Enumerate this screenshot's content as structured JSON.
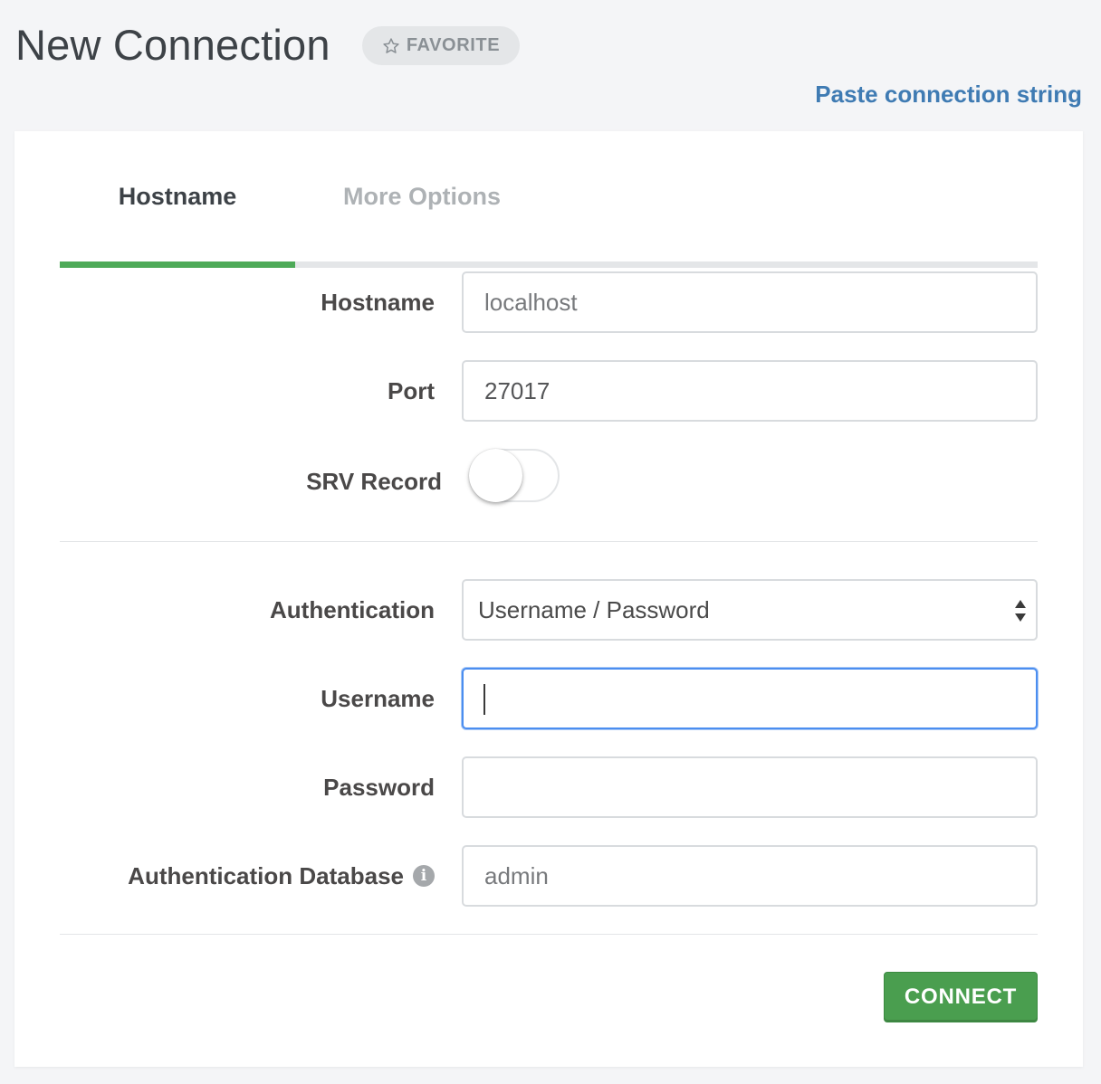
{
  "header": {
    "title": "New Connection",
    "favorite_label": "FAVORITE",
    "favorite_icon": "star-outline-icon",
    "paste_link": "Paste connection string"
  },
  "tabs": [
    {
      "label": "Hostname",
      "active": true
    },
    {
      "label": "More Options",
      "active": false
    }
  ],
  "form": {
    "hostname": {
      "label": "Hostname",
      "placeholder": "localhost",
      "value": ""
    },
    "port": {
      "label": "Port",
      "value": "27017"
    },
    "srv_record": {
      "label": "SRV Record",
      "enabled": false
    },
    "authentication": {
      "label": "Authentication",
      "selected": "Username / Password"
    },
    "username": {
      "label": "Username",
      "value": "",
      "focused": true
    },
    "password": {
      "label": "Password",
      "value": ""
    },
    "auth_database": {
      "label": "Authentication Database",
      "placeholder": "admin",
      "info_icon": "info-icon"
    }
  },
  "actions": {
    "connect_label": "CONNECT"
  },
  "colors": {
    "accent_green": "#4eaa58",
    "link_blue": "#3f7bb3",
    "focus_blue": "#4b8ef0",
    "button_green": "#4a9e4f"
  }
}
